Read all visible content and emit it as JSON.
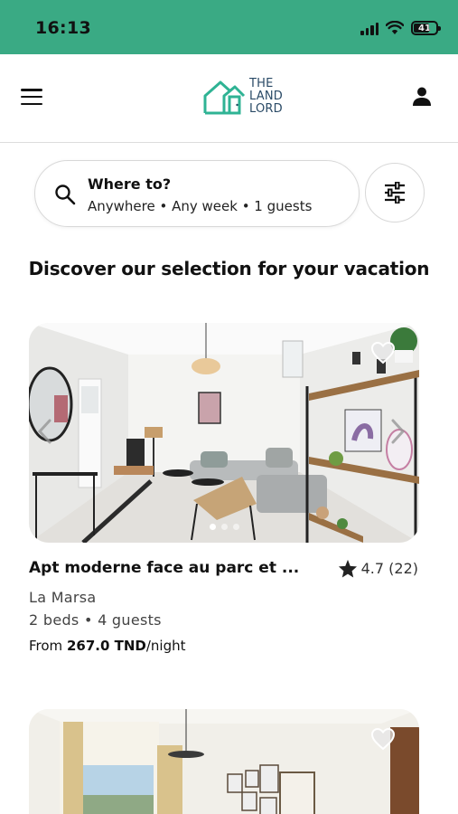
{
  "status_bar": {
    "time": "16:13",
    "battery_level": "41",
    "icons": [
      "signal-icon",
      "wifi-icon",
      "battery-icon"
    ],
    "background_color": "#3aaa84"
  },
  "header": {
    "menu_icon": "hamburger-menu-icon",
    "logo": {
      "line1": "THE",
      "line2": "LAND",
      "line3": "LORD",
      "accent_color": "#2fb394"
    },
    "user_icon": "user-icon"
  },
  "search": {
    "title": "Where to?",
    "subtitle": "Anywhere • Any week • 1 guests",
    "icon": "search-icon",
    "filter_icon": "filter-sliders-icon"
  },
  "section_title": "Discover our selection for your vacation",
  "listings": [
    {
      "title": "Apt moderne face au parc et ...",
      "rating": "4.7 (22)",
      "location": "La Marsa",
      "details": "2 beds • 4 guests",
      "price_prefix": "From",
      "price_value": "267.0 TND",
      "price_suffix": "/night",
      "photo": "living-room-photo"
    },
    {
      "photo": "bedroom-photo"
    }
  ]
}
